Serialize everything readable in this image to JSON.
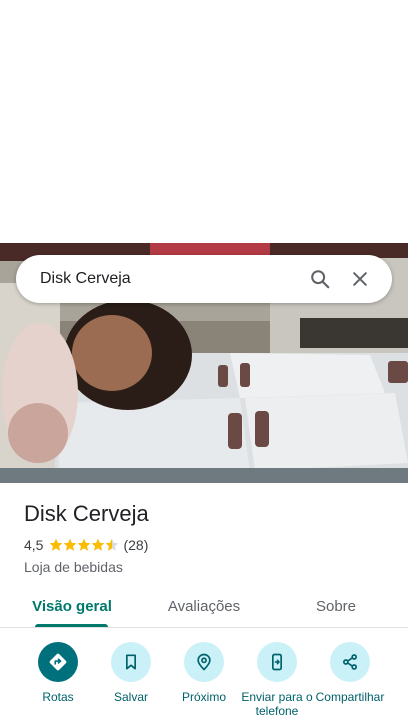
{
  "search": {
    "query": "Disk Cerveja"
  },
  "place": {
    "name": "Disk Cerveja",
    "rating": "4,5",
    "rating_value": 4.5,
    "reviews": "(28)",
    "category": "Loja de bebidas"
  },
  "tabs": [
    {
      "label": "Visão geral",
      "active": true
    },
    {
      "label": "Avaliações",
      "active": false
    },
    {
      "label": "Sobre",
      "active": false
    }
  ],
  "actions": [
    {
      "label": "Rotas",
      "icon": "directions-icon"
    },
    {
      "label": "Salvar",
      "icon": "bookmark-icon"
    },
    {
      "label": "Próximo",
      "icon": "nearby-icon"
    },
    {
      "label": "Enviar para o telefone",
      "icon": "send-to-phone-icon"
    },
    {
      "label": "Compartilhar",
      "icon": "share-icon"
    }
  ],
  "colors": {
    "accent": "#00796b",
    "action_bg": "#c9f1f7",
    "action_primary_bg": "#00707c",
    "star": "#fbbc04"
  }
}
